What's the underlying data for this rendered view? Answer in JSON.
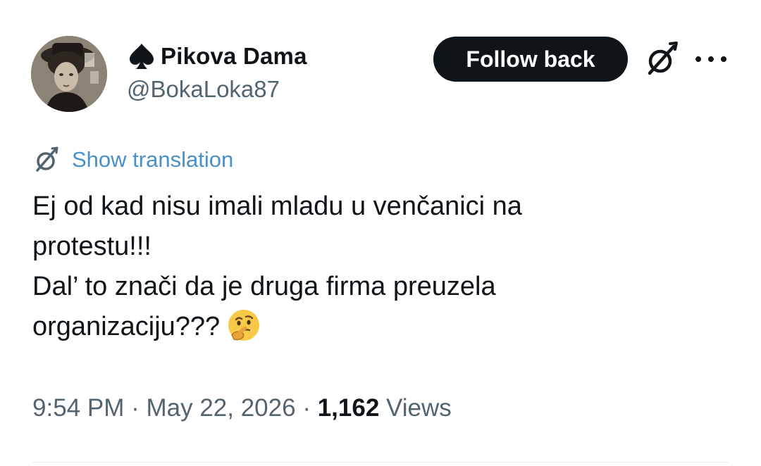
{
  "author": {
    "display_name": "Pikova Dama",
    "handle": "@BokaLoka87",
    "name_icon": "spade-icon",
    "avatar": "vintage-portrait-avatar"
  },
  "actions": {
    "follow_label": "Follow back",
    "grok_icon": "grok-icon",
    "more_icon": "more-icon"
  },
  "translation": {
    "icon": "translate-icon",
    "label": "Show translation",
    "color": "#4a90c9"
  },
  "tweet": {
    "lines": [
      "Ej od kad nisu imali mladu u venčanici na",
      "protestu!!!",
      "Dal’ to znači da je druga firma preuzela",
      "organizaciju???"
    ],
    "emoji": "thinking-face-emoji"
  },
  "meta": {
    "time": "9:54 PM",
    "separator": "·",
    "date": "May 22, 2026",
    "views_count": "1,162",
    "views_label": "Views"
  },
  "colors": {
    "text": "#0f1419",
    "secondary": "#536471",
    "button_bg": "#0f1419"
  }
}
